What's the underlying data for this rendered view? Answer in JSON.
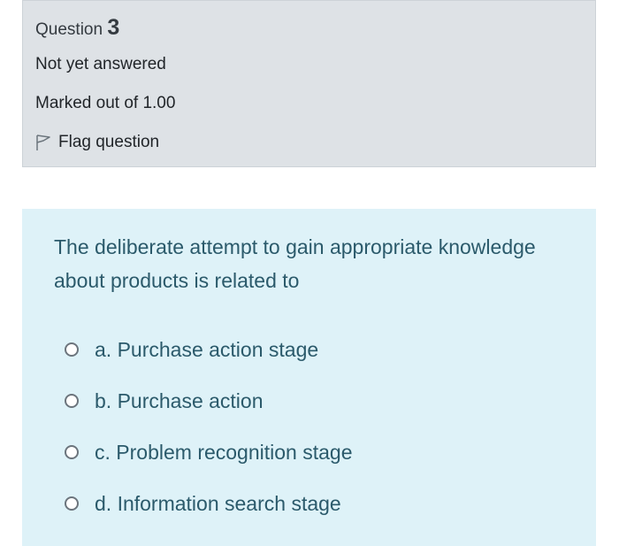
{
  "question": {
    "title_prefix": "Question",
    "number": "3",
    "state": "Not yet answered",
    "grade": "Marked out of 1.00",
    "flag_label": "Flag question",
    "flag_icon": "flag-icon",
    "text": "The deliberate attempt to gain appropriate knowledge about products is related to"
  },
  "answers": [
    {
      "label": "a. Purchase action stage",
      "selected": false
    },
    {
      "label": "b. Purchase action",
      "selected": false
    },
    {
      "label": "c. Problem recognition stage",
      "selected": false
    },
    {
      "label": "d. Information search stage",
      "selected": false
    }
  ],
  "colors": {
    "info_background": "#dee2e6",
    "content_background": "#def2f8",
    "question_text": "#2b5a6b"
  }
}
